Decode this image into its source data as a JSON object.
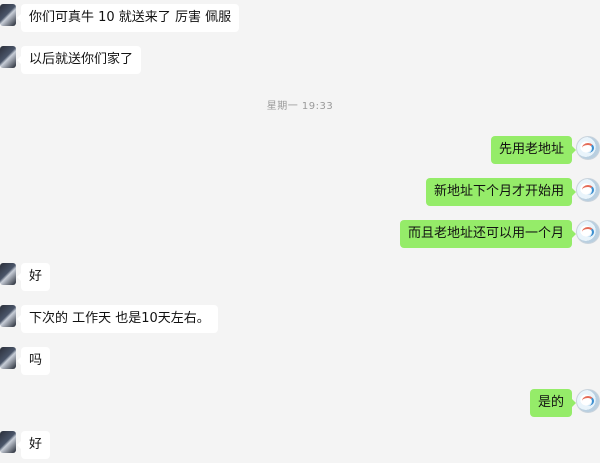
{
  "messages": [
    {
      "side": "in",
      "text": "你们可真牛 10 就送来了 厉害 佩服"
    },
    {
      "side": "in",
      "text": "以后就送你们家了"
    },
    {
      "side": "out",
      "text": "先用老地址"
    },
    {
      "side": "out",
      "text": "新地址下个月才开始用"
    },
    {
      "side": "out",
      "text": "而且老地址还可以用一个月"
    },
    {
      "side": "in",
      "text": "好"
    },
    {
      "side": "in",
      "text": "下次的 工作天 也是10天左右。"
    },
    {
      "side": "in",
      "text": "吗"
    },
    {
      "side": "out",
      "text": "是的"
    },
    {
      "side": "in",
      "text": "好"
    }
  ],
  "timestamp": "星期一 19:33"
}
